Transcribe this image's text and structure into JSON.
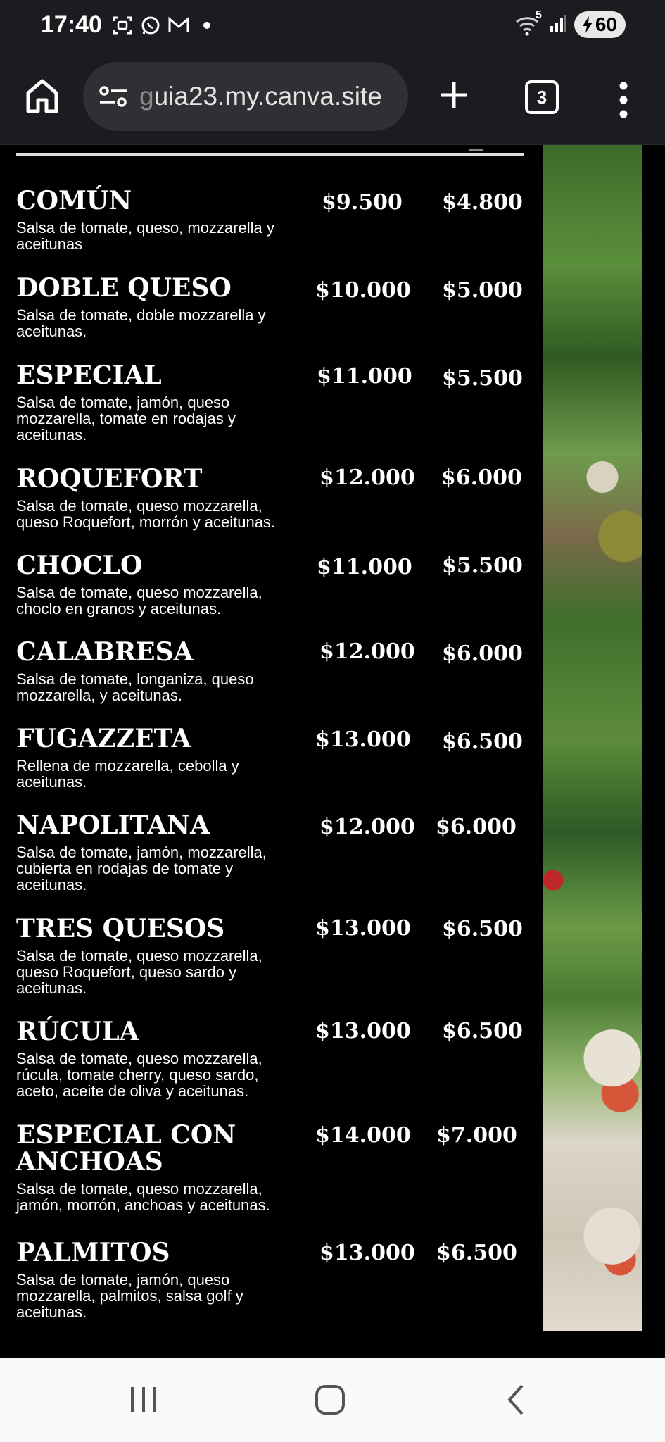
{
  "status_bar": {
    "time": "17:40",
    "notification_icons": [
      "screenshot-icon",
      "whatsapp-icon",
      "gmail-icon",
      "dot-icon"
    ],
    "wifi_label": "5",
    "battery": "60"
  },
  "browser": {
    "url_fade": "g",
    "url": "uia23.my.canva.site",
    "tab_count": "3"
  },
  "menu": {
    "items": [
      {
        "name": "COMÚN",
        "desc": "Salsa de tomate, queso, mozzarella y aceitunas",
        "price_full": "$9.500",
        "price_half": "$4.800"
      },
      {
        "name": "DOBLE QUESO",
        "desc": "Salsa de tomate, doble mozzarella y aceitunas.",
        "price_full": "$10.000",
        "price_half": "$5.000"
      },
      {
        "name": "ESPECIAL",
        "desc": "Salsa de tomate, jamón, queso mozzarella, tomate en rodajas y aceitunas.",
        "price_full": "$11.000",
        "price_half": "$5.500"
      },
      {
        "name": "ROQUEFORT",
        "desc": "Salsa de tomate, queso mozzarella, queso Roquefort, morrón y aceitunas.",
        "price_full": "$12.000",
        "price_half": "$6.000"
      },
      {
        "name": "CHOCLO",
        "desc": "Salsa de tomate, queso mozzarella, choclo en granos y aceitunas.",
        "price_full": "$11.000",
        "price_half": "$5.500"
      },
      {
        "name": "CALABRESA",
        "desc": "Salsa de tomate, longaniza, queso mozzarella, y aceitunas.",
        "price_full": "$12.000",
        "price_half": "$6.000"
      },
      {
        "name": "FUGAZZETA",
        "desc": "Rellena de mozzarella, cebolla y aceitunas.",
        "price_full": "$13.000",
        "price_half": "$6.500"
      },
      {
        "name": "NAPOLITANA",
        "desc": "Salsa de tomate, jamón, mozzarella, cubierta en rodajas de tomate y aceitunas.",
        "price_full": "$12.000",
        "price_half": "$6.000"
      },
      {
        "name": "TRES QUESOS",
        "desc": "Salsa de tomate, queso mozzarella, queso Roquefort, queso sardo y aceitunas.",
        "price_full": "$13.000",
        "price_half": "$6.500"
      },
      {
        "name": "RÚCULA",
        "desc": "Salsa de tomate, queso mozzarella, rúcula, tomate cherry, queso sardo, aceto, aceite de oliva y aceitunas.",
        "price_full": "$13.000",
        "price_half": "$6.500"
      },
      {
        "name": "ESPECIAL CON ANCHOAS",
        "desc": "Salsa de tomate, queso mozzarella, jamón, morrón, anchoas y aceitunas.",
        "price_full": "$14.000",
        "price_half": "$7.000"
      },
      {
        "name": "PALMITOS",
        "desc": "Salsa de tomate, jamón, queso mozzarella, palmitos, salsa golf y aceitunas.",
        "price_full": "$13.000",
        "price_half": "$6.500"
      }
    ]
  },
  "nav_bar": {
    "buttons": [
      "recents-icon",
      "home-icon",
      "back-icon"
    ]
  }
}
